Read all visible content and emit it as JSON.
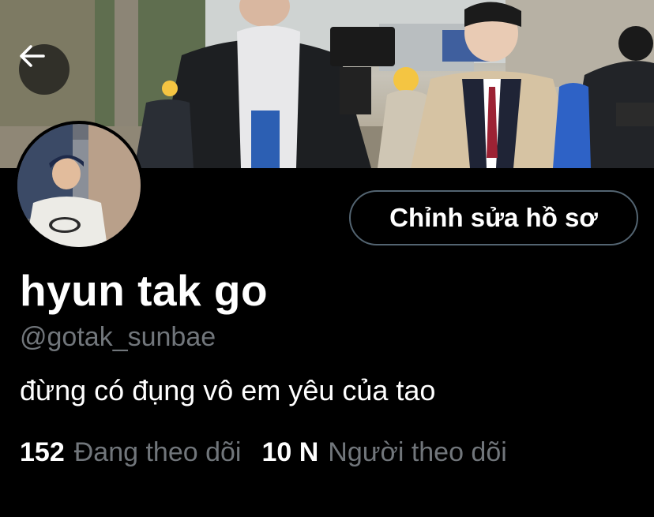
{
  "profile": {
    "display_name": "hyun tak go",
    "handle": "@gotak_sunbae",
    "bio": "đừng có đụng vô em yêu của tao",
    "edit_button_label": "Chỉnh sửa hồ sơ"
  },
  "stats": {
    "following_count": "152",
    "following_label": "Đang theo dõi",
    "followers_count": "10 N",
    "followers_label": "Người theo dõi"
  },
  "icons": {
    "back": "arrow-left-icon"
  },
  "colors": {
    "background": "#000000",
    "secondary_text": "#71767b",
    "button_border": "#536471"
  }
}
